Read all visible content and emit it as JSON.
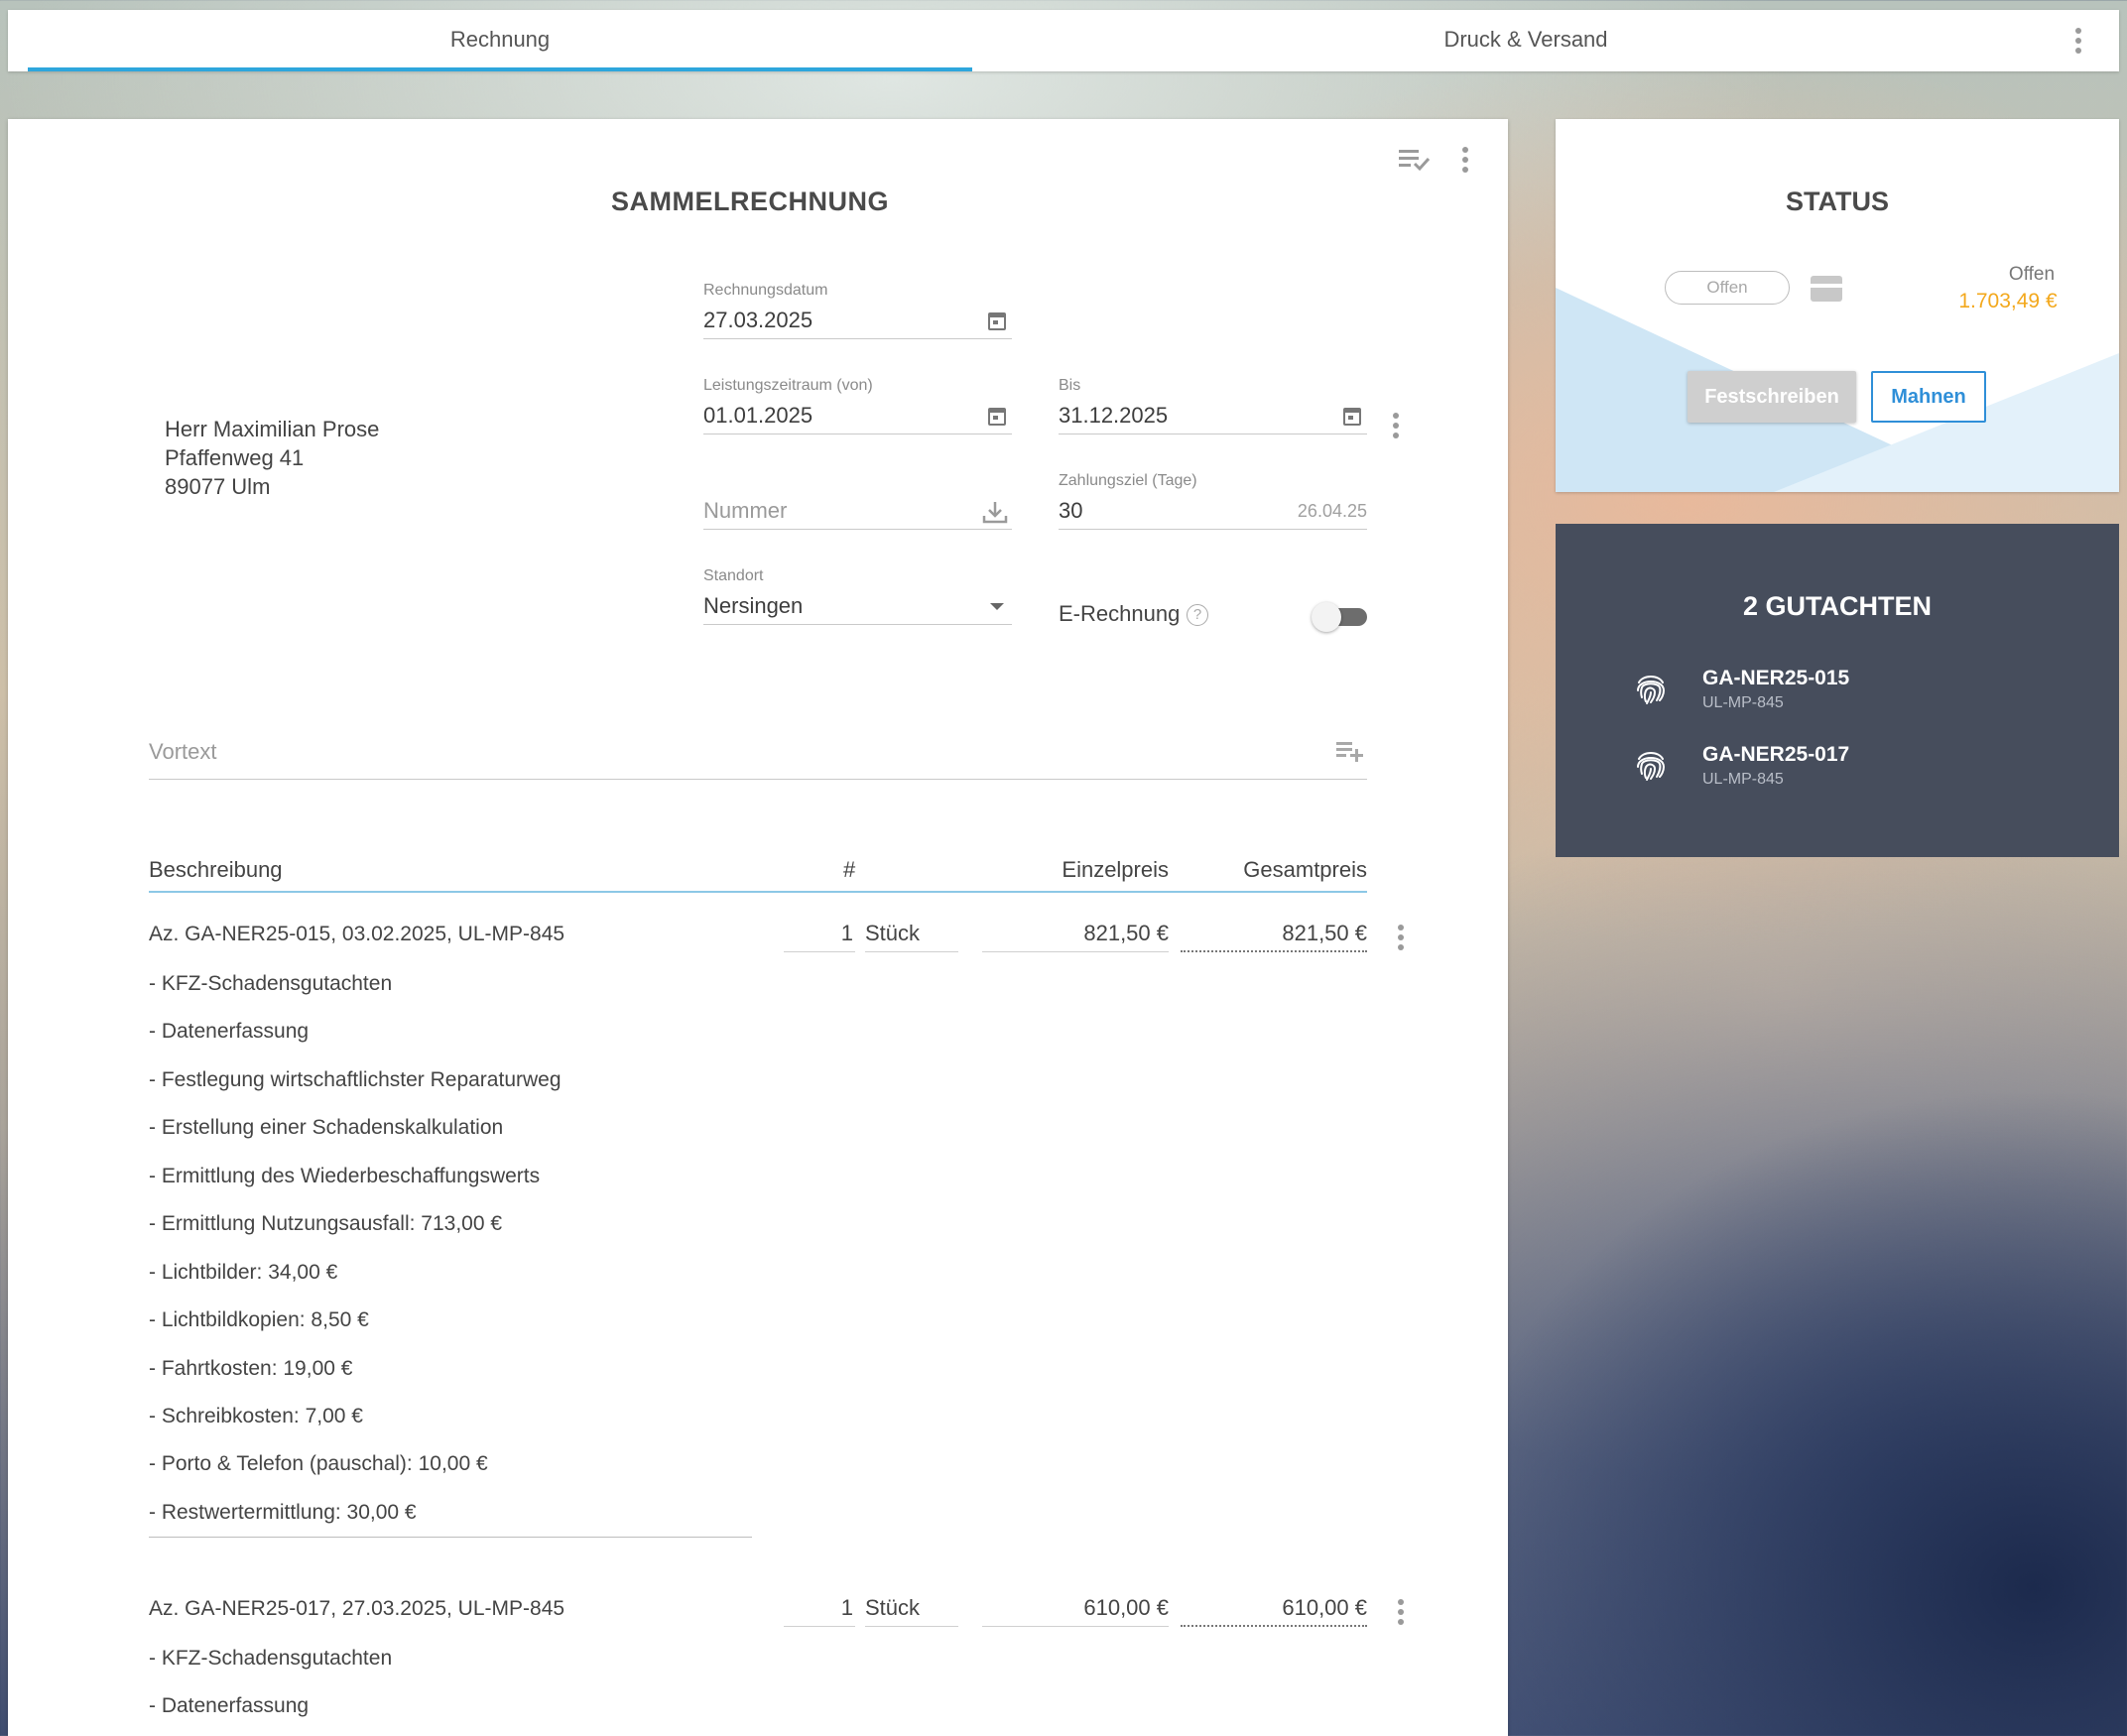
{
  "tabs": [
    {
      "label": "Rechnung",
      "active": true
    },
    {
      "label": "Druck & Versand",
      "active": false
    }
  ],
  "invoice": {
    "title": "SAMMELRECHNUNG",
    "recipient": {
      "name": "Herr Maximilian Prose",
      "street": "Pfaffenweg 41",
      "city": "89077 Ulm"
    },
    "fields": {
      "rechnungsdatum": {
        "label": "Rechnungsdatum",
        "value": "27.03.2025"
      },
      "leistung_von": {
        "label": "Leistungszeitraum (von)",
        "value": "01.01.2025"
      },
      "bis": {
        "label": "Bis",
        "value": "31.12.2025"
      },
      "nummer": {
        "placeholder": "Nummer"
      },
      "zahlungsziel": {
        "label": "Zahlungsziel (Tage)",
        "value": "30",
        "due_date": "26.04.25"
      },
      "standort": {
        "label": "Standort",
        "value": "Nersingen"
      },
      "erechnung": {
        "label": "E-Rechnung",
        "help": "?",
        "enabled": false
      }
    },
    "vortext_placeholder": "Vortext",
    "columns": {
      "description": "Beschreibung",
      "count": "#",
      "unit_price": "Einzelpreis",
      "total": "Gesamtpreis"
    },
    "items": [
      {
        "title": "Az. GA-NER25-015, 03.02.2025, UL-MP-845",
        "qty": "1",
        "unit": "Stück",
        "unit_price": "821,50 €",
        "total": "821,50 €",
        "lines": [
          "- KFZ-Schadensgutachten",
          "- Datenerfassung",
          "- Festlegung wirtschaftlichster Reparaturweg",
          "- Erstellung einer Schadenskalkulation",
          "- Ermittlung des Wiederbeschaffungswerts",
          "- Ermittlung Nutzungsausfall: 713,00 €",
          "- Lichtbilder: 34,00 €",
          "- Lichtbildkopien: 8,50 €",
          "- Fahrtkosten: 19,00 €",
          "- Schreibkosten: 7,00 €",
          "- Porto & Telefon (pauschal): 10,00 €",
          "- Restwertermittlung: 30,00 €"
        ]
      },
      {
        "title": "Az. GA-NER25-017, 27.03.2025, UL-MP-845",
        "qty": "1",
        "unit": "Stück",
        "unit_price": "610,00 €",
        "total": "610,00 €",
        "lines": [
          "- KFZ-Schadensgutachten",
          "- Datenerfassung"
        ]
      }
    ]
  },
  "status": {
    "title": "STATUS",
    "pill": "Offen",
    "open_label": "Offen",
    "open_amount": "1.703,49 €",
    "btn_festschreiben": "Festschreiben",
    "btn_mahnen": "Mahnen",
    "amount_color": "#f3a81c",
    "accent_color": "#2f8fd8"
  },
  "gutachten": {
    "title": "2 GUTACHTEN",
    "items": [
      {
        "id": "GA-NER25-015",
        "plate": "UL-MP-845",
        "icon": "fingerprint-icon"
      },
      {
        "id": "GA-NER25-017",
        "plate": "UL-MP-845",
        "icon": "fingerprint-icon"
      }
    ]
  }
}
